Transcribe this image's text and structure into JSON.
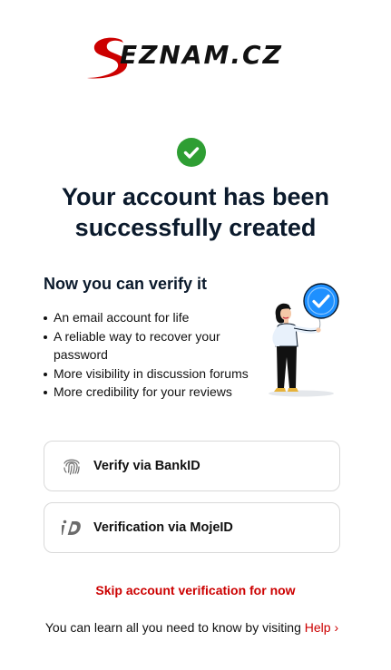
{
  "brand": {
    "logo_text": "EZNAM.CZ",
    "logo_letter": "S",
    "logo_alt": "Seznam.cz",
    "accent_color": "#cc0000"
  },
  "success": {
    "icon": "check-circle-icon",
    "badge_color": "#2e9e33",
    "title": "Your account has been successfully created"
  },
  "verify": {
    "heading": "Now you can verify it",
    "benefits": [
      "An email account for life",
      "A reliable way to recover your password",
      "More visibility in discussion forums",
      "More credibility for your reviews"
    ],
    "illustration_icon": "verified-badge-icon",
    "badge_color": "#1e90ff"
  },
  "options": [
    {
      "label": "Verify via BankID",
      "icon": "fingerprint-icon"
    },
    {
      "label": "Verification via MojeID",
      "icon": "mojeid-icon"
    }
  ],
  "skip_label": "Skip account verification for now",
  "help": {
    "text": "You can learn all you need to know by visiting",
    "link_label": "Help ›"
  }
}
